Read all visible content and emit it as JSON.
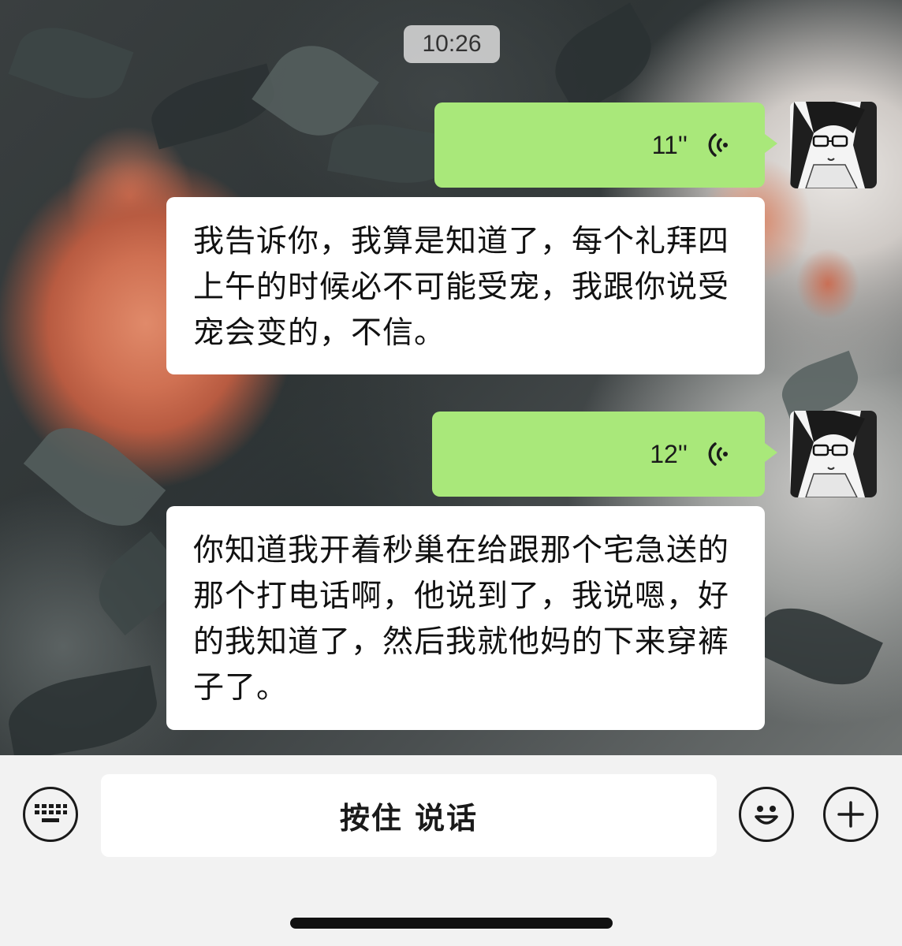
{
  "header": {
    "time": "10:26"
  },
  "messages": [
    {
      "type": "voice",
      "sender": "me",
      "duration": "11''"
    },
    {
      "type": "text",
      "sender": "other",
      "text": "我告诉你，我算是知道了，每个礼拜四上午的时候必不可能受宠，我跟你说受宠会变的，不信。"
    },
    {
      "type": "voice",
      "sender": "me",
      "duration": "12''"
    },
    {
      "type": "text",
      "sender": "other",
      "text": "你知道我开着秒巢在给跟那个宅急送的那个打电话啊，他说到了，我说嗯，好的我知道了，然后我就他妈的下来穿裤子了。"
    }
  ],
  "input_bar": {
    "hold_to_talk": "按住 说话",
    "icons": [
      "keyboard-icon",
      "emoji-icon",
      "plus-icon"
    ]
  },
  "colors": {
    "voice_bubble": "#a9e87a",
    "text_bubble": "#ffffff",
    "bar": "#f2f2f2"
  }
}
